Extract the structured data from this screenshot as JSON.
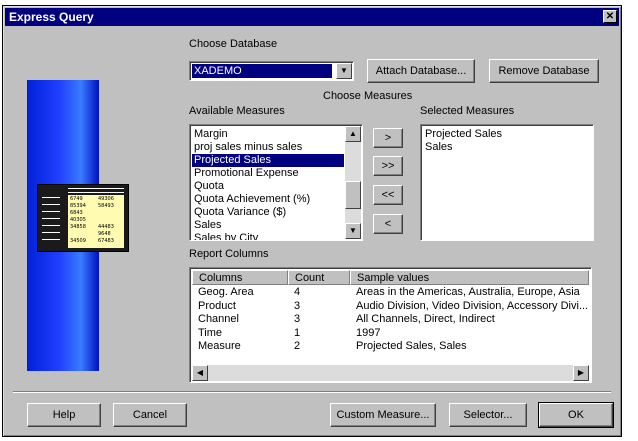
{
  "window": {
    "title": "Express Query",
    "close_glyph": "✕"
  },
  "database": {
    "label": "Choose Database",
    "selected": "XADEMO",
    "attach_label": "Attach Database...",
    "remove_label": "Remove Database"
  },
  "measures": {
    "section_label": "Choose Measures",
    "available_label": "Available Measures",
    "available_items": [
      "Margin",
      "proj sales minus sales",
      "Projected Sales",
      "Promotional Expense",
      "Quota",
      "Quota Achievement (%)",
      "Quota Variance ($)",
      "Sales",
      "Sales by City"
    ],
    "available_selected_index": 2,
    "selected_label": "Selected Measures",
    "selected_items": [
      "Projected Sales",
      "Sales"
    ],
    "move_buttons": [
      ">",
      ">>",
      "<<",
      "<"
    ]
  },
  "report": {
    "label": "Report Columns",
    "headers": [
      "Columns",
      "Count",
      "Sample values"
    ],
    "rows": [
      [
        "Geog. Area",
        "4",
        "Areas in the Americas, Australia, Europe, Asia"
      ],
      [
        "Product",
        "3",
        "Audio Division, Video Division, Accessory Divi..."
      ],
      [
        "Channel",
        "3",
        "All Channels, Direct, Indirect"
      ],
      [
        "Time",
        "1",
        "1997"
      ],
      [
        "Measure",
        "2",
        "Projected Sales, Sales"
      ]
    ]
  },
  "footer": {
    "help_label": "Help",
    "cancel_label": "Cancel",
    "custom_label": "Custom Measure...",
    "selector_label": "Selector...",
    "ok_label": "OK"
  },
  "illustration": {
    "left_column": [
      "6749",
      "85394",
      "6843",
      "40305",
      "34858",
      "",
      "34509"
    ],
    "right_column": [
      "49306",
      "58493",
      "",
      "",
      "44483",
      "9648",
      "67483"
    ]
  },
  "colors": {
    "titlebar": "#000080",
    "face": "#c0c0c0",
    "highlight": "#000080"
  }
}
